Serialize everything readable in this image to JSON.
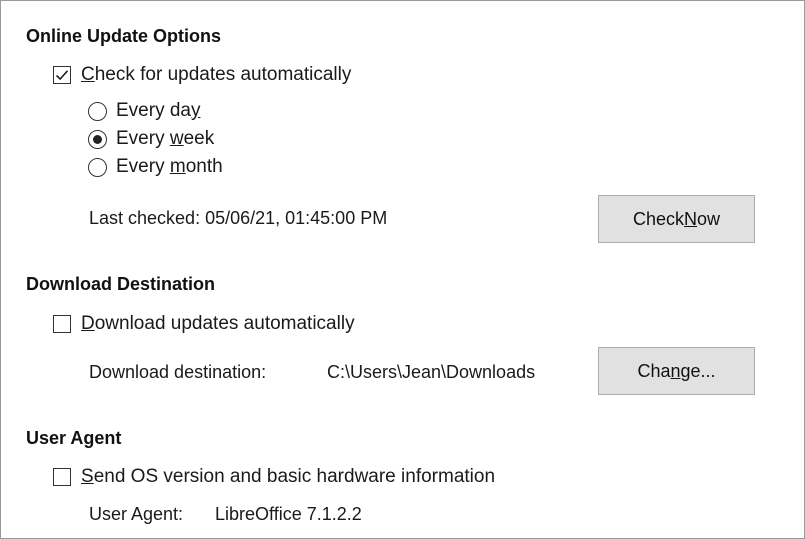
{
  "online_update": {
    "title": "Online Update Options",
    "check_auto": {
      "pre": "",
      "mn": "C",
      "post": "heck for updates automatically",
      "checked": true
    },
    "every_day": {
      "pre": "Every da",
      "mn": "y",
      "post": "",
      "checked": false
    },
    "every_week": {
      "pre": "Every ",
      "mn": "w",
      "post": "eek",
      "checked": true
    },
    "every_month": {
      "pre": "Every ",
      "mn": "m",
      "post": "onth",
      "checked": false
    },
    "last_checked": "Last checked: 05/06/21, 01:45:00 PM",
    "check_now": {
      "pre": "Check ",
      "mn": "N",
      "post": "ow"
    }
  },
  "download": {
    "title": "Download Destination",
    "download_auto": {
      "pre": "",
      "mn": "D",
      "post": "ownload updates automatically",
      "checked": false
    },
    "destination_label": "Download destination:",
    "destination_value": "C:\\Users\\Jean\\Downloads",
    "change": {
      "pre": "Cha",
      "mn": "n",
      "post": "ge..."
    }
  },
  "user_agent": {
    "title": "User Agent",
    "send_os": {
      "pre": "",
      "mn": "S",
      "post": "end OS version and basic hardware information",
      "checked": false
    },
    "agent_label": "User Agent:",
    "agent_value": "LibreOffice 7.1.2.2"
  }
}
